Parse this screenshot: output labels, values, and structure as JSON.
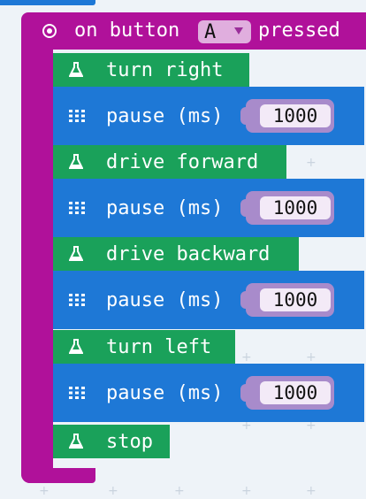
{
  "event": {
    "prefix": "on button",
    "button_value": "A",
    "suffix": "pressed"
  },
  "blocks": [
    {
      "type": "robot",
      "label": "turn right"
    },
    {
      "type": "pause",
      "label": "pause (ms)",
      "value": "1000"
    },
    {
      "type": "robot",
      "label": "drive forward"
    },
    {
      "type": "pause",
      "label": "pause (ms)",
      "value": "1000"
    },
    {
      "type": "robot",
      "label": "drive backward"
    },
    {
      "type": "pause",
      "label": "pause (ms)",
      "value": "1000"
    },
    {
      "type": "robot",
      "label": "turn left"
    },
    {
      "type": "pause",
      "label": "pause (ms)",
      "value": "1000"
    },
    {
      "type": "robot",
      "label": "stop"
    }
  ],
  "icons": {
    "event": "target-icon",
    "robot": "flask-icon",
    "pause": "grid-icon",
    "dropdown": "caret-down-icon"
  },
  "colors": {
    "event": "#b0119a",
    "robot": "#1aa15a",
    "pause": "#1e78d6",
    "number_pill": "#a88bcb",
    "workspace": "#eef3f8"
  }
}
